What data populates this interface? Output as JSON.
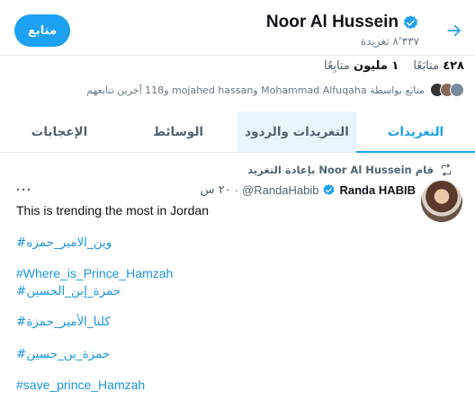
{
  "header": {
    "title": "Noor Al Hussein",
    "tweet_count": "٨٬٣٣٧ تغريدة",
    "follow_label": "متابع"
  },
  "stats": {
    "following_count": "٤٢٨",
    "following_label": "متابَعًا",
    "followers_count": "١ مليون",
    "followers_label": "متابِعًا"
  },
  "followers_you_know": "متابَع بواسطة Mohammad Alfuqaha وmojahed hassan و118 آخرين تتابعهم",
  "tabs": [
    {
      "label": "التغريدات"
    },
    {
      "label": "التغريدات والردود"
    },
    {
      "label": "الوسائط"
    },
    {
      "label": "الإعجابات"
    }
  ],
  "tweet": {
    "retweet_text": "قام Noor Al Hussein بإعادة التغريد",
    "author": "Randa HABIB",
    "handle": "@RandaHabib",
    "time": "٢٠ س",
    "text": "This is trending the most in Jordan",
    "hashtags": [
      "#وين_الامير_حمزه",
      "#Where_is_Prince_Hamzah",
      "#حمزة_إبن_الحسين",
      "#كلنا_الأمير_حمزة",
      "#حمزة_بن_حسين",
      "#save_prince_Hamzah"
    ]
  },
  "colors": {
    "accent": "#1da1f2",
    "hashtag": "#1b95e0",
    "secondary_text": "#536471"
  }
}
